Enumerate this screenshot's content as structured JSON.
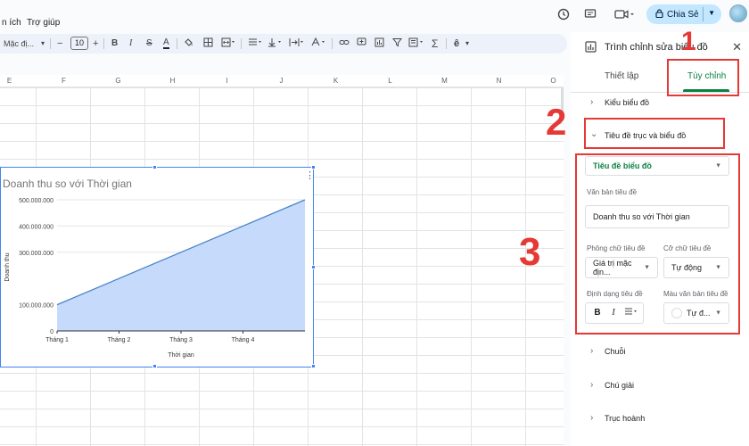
{
  "menu": {
    "items": [
      "n ích",
      "Trợ giúp"
    ]
  },
  "topbar": {
    "share_label": "Chia Sẻ",
    "icons": [
      "history-icon",
      "comment-icon",
      "meet-icon",
      "lock-icon",
      "avatar"
    ]
  },
  "toolbar": {
    "font_name": "Mặc đị...",
    "font_size": "10",
    "bold": "B",
    "italic": "I",
    "strike": "S",
    "text_color": "A",
    "sigma": "Σ"
  },
  "grid": {
    "columns": [
      "E",
      "F",
      "G",
      "H",
      "I",
      "J",
      "K",
      "L",
      "M",
      "N",
      "O"
    ]
  },
  "chart_data": {
    "type": "area",
    "title": "Doanh thu so với Thời gian",
    "xlabel": "Thời gian",
    "ylabel": "Doanh thu",
    "categories": [
      "Tháng 1",
      "Tháng 2",
      "Tháng 3",
      "Tháng 4"
    ],
    "x_points": [
      1,
      5
    ],
    "values": [
      100000000,
      500000000
    ],
    "ylim": [
      0,
      500000000
    ],
    "yticks": [
      "0",
      "100.000.000",
      "300.000.000",
      "400.000.000",
      "500.000.000"
    ],
    "ytick_values": [
      0,
      100000000,
      300000000,
      400000000,
      500000000
    ],
    "fill_color": "#c6dafc",
    "line_color": "#4a86c8",
    "grid": true
  },
  "panel": {
    "title": "Trình chỉnh sửa biểu đồ",
    "tabs": {
      "setup": "Thiết lập",
      "customize": "Tùy chỉnh"
    },
    "sections": {
      "chart_type": "Kiểu biểu đồ",
      "titles": "Tiêu đề trục và biểu đồ",
      "series": "Chuỗi",
      "legend": "Chú giải",
      "h_axis": "Trục hoành"
    },
    "title_select": "Tiêu đề biểu đồ",
    "title_text_label": "Văn bản tiêu đề",
    "title_text_value": "Doanh thu so với Thời gian",
    "font_label": "Phông chữ tiêu đề",
    "font_value": "Giá trị mặc địn...",
    "size_label": "Cỡ chữ tiêu đề",
    "size_value": "Tự động",
    "format_label": "Định dạng tiêu đề",
    "color_label": "Màu văn bản tiêu đề",
    "color_value": "Tự đ..."
  },
  "annotations": {
    "step1": "1",
    "step2": "2",
    "step3": "3"
  },
  "colors": {
    "accent_green": "#0b8043",
    "annotation_red": "#e53935",
    "share_bg": "#c2e7ff"
  }
}
